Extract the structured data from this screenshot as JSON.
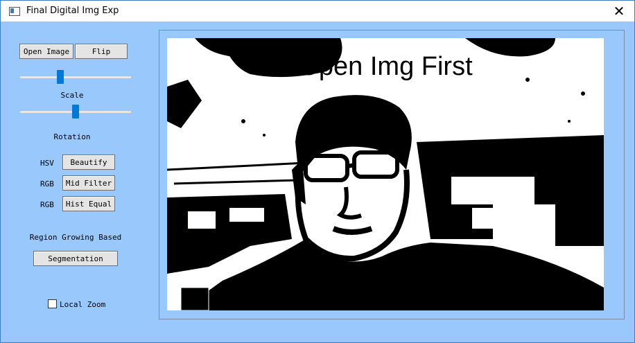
{
  "window": {
    "title": "Final Digital Img Exp",
    "close_glyph": "✕"
  },
  "controls": {
    "open_image": "Open Image",
    "flip": "Flip",
    "scale_label": "Scale",
    "scale_value": 0.35,
    "rotation_label": "Rotation",
    "rotation_value": 0.5,
    "rows": [
      {
        "prefix": "HSV",
        "button": "Beautify"
      },
      {
        "prefix": "RGB",
        "button": "Mid Filter"
      },
      {
        "prefix": "RGB",
        "button": "Hist Equal"
      }
    ],
    "region_label": "Region Growing Based",
    "segmentation": "Segmentation",
    "local_zoom": "Local Zoom",
    "local_zoom_checked": false
  },
  "display": {
    "overlay_text": "Open Img First"
  },
  "colors": {
    "background": "#99c8fd",
    "slider_thumb": "#0078d7"
  }
}
